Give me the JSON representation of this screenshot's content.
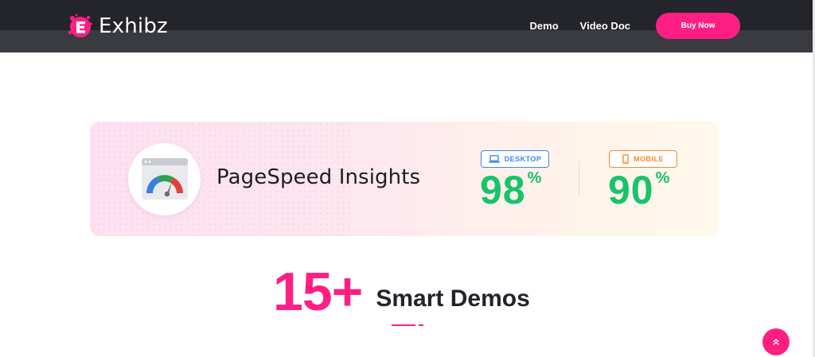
{
  "header": {
    "logo_text": "Exhibz",
    "logo_icon": "exhibz-e-splash-icon",
    "nav": [
      {
        "label": "Demo"
      },
      {
        "label": "Video Doc"
      }
    ],
    "buy_button": "Buy Now"
  },
  "pagespeed": {
    "icon": "pagespeed-gauge-icon",
    "title": "PageSpeed Insights",
    "desktop": {
      "label": "DESKTOP",
      "icon": "laptop-icon",
      "score": "98",
      "unit": "%",
      "color": "#3a8ae6"
    },
    "mobile": {
      "label": "MOBILE",
      "icon": "smartphone-icon",
      "score": "90",
      "unit": "%",
      "color": "#f6892d"
    },
    "score_color": "#18c36a"
  },
  "demos": {
    "count": "15+",
    "label": "Smart Demos"
  },
  "scroll_top": {
    "icon": "double-chevron-up-icon"
  },
  "colors": {
    "accent": "#ff1e83",
    "header_bg": "#24252a"
  }
}
